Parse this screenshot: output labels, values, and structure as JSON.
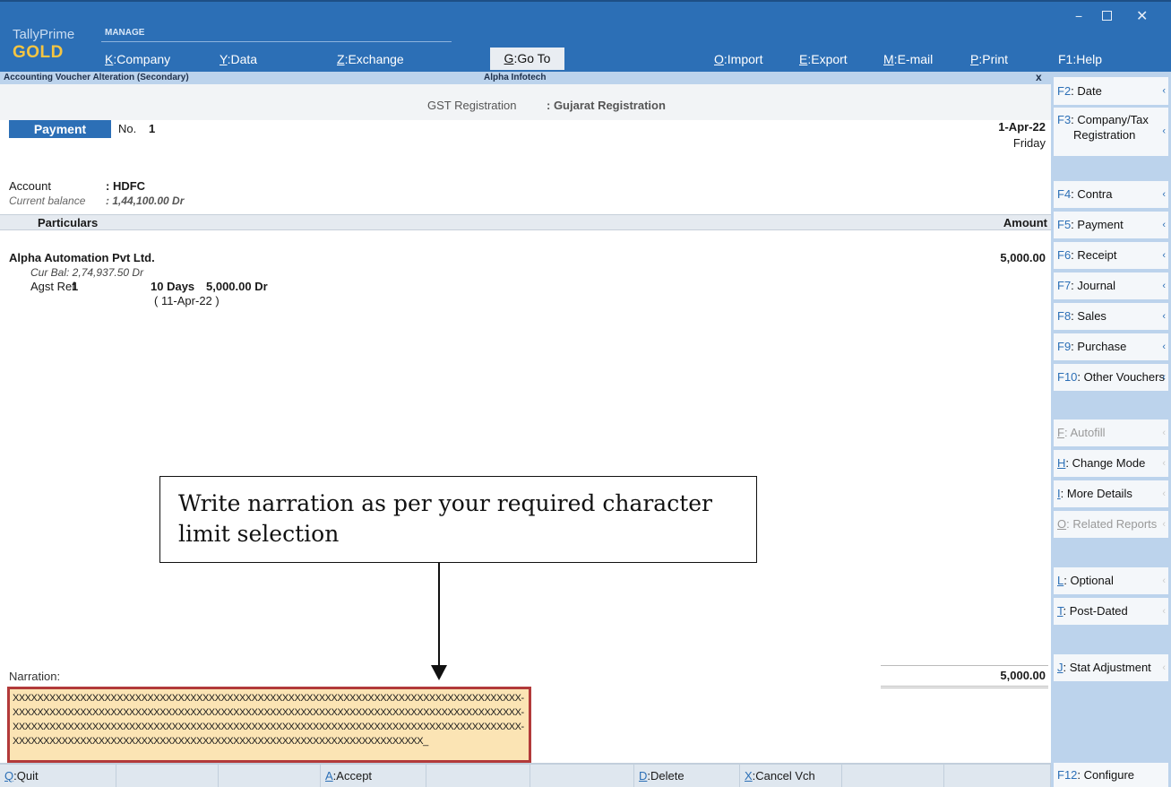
{
  "header": {
    "product": "TallyPrime",
    "edition": "GOLD",
    "manage_label": "MANAGE",
    "menu": [
      {
        "key": "K",
        "label": "Company"
      },
      {
        "key": "Y",
        "label": "Data"
      },
      {
        "key": "Z",
        "label": "Exchange"
      },
      {
        "key": "G",
        "label": "Go To"
      },
      {
        "key": "O",
        "label": "Import"
      },
      {
        "key": "E",
        "label": "Export"
      },
      {
        "key": "M",
        "label": "E-mail"
      },
      {
        "key": "P",
        "label": "Print"
      },
      {
        "key": "F1",
        "label": "Help"
      }
    ],
    "window_controls": {
      "minimize": "−",
      "close": "✕"
    }
  },
  "subbar": {
    "screen_title": "Accounting Voucher Alteration (Secondary)",
    "company": "Alpha Infotech",
    "close": "x"
  },
  "voucher": {
    "gst_label": "GST Registration",
    "gst_value": ": Gujarat Registration",
    "type": "Payment",
    "no_label": "No.",
    "no": "1",
    "date": "1-Apr-22",
    "day": "Friday",
    "account_label": "Account",
    "account_value": ": HDFC",
    "balance_label": "Current balance",
    "balance_value": ": 1,44,100.00 Dr",
    "particulars_header": "Particulars",
    "amount_header": "Amount",
    "entry": {
      "ledger": "Alpha Automation Pvt Ltd.",
      "amount": "5,000.00",
      "cur_bal": "Cur Bal:  2,74,937.50 Dr",
      "agst_label": "Agst Ref",
      "agst_ref": "1",
      "days": "10 Days",
      "agst_amount": "5,000.00 Dr",
      "due_date": "( 11-Apr-22 )"
    },
    "narration_label": "Narration:",
    "total": "5,000.00",
    "narration_lines": [
      "XXXXXXXXXXXXXXXXXXXXXXXXXXXXXXXXXXXXXXXXXXXXXXXXXXXXXXXXXXXXXXXXXXXXXXXXXXXXXXXXXXX-",
      "XXXXXXXXXXXXXXXXXXXXXXXXXXXXXXXXXXXXXXXXXXXXXXXXXXXXXXXXXXXXXXXXXXXXXXXXXXXXXXXXXXX-",
      "XXXXXXXXXXXXXXXXXXXXXXXXXXXXXXXXXXXXXXXXXXXXXXXXXXXXXXXXXXXXXXXXXXXXXXXXXXXXXXXXXXX-",
      "XXXXXXXXXXXXXXXXXXXXXXXXXXXXXXXXXXXXXXXXXXXXXXXXXXXXXXXXXXXXXXXXXXX_"
    ]
  },
  "callout": {
    "text": "Write narration as per your required character limit selection"
  },
  "bottombar": [
    {
      "key": "Q",
      "label": "Quit"
    },
    {
      "key": "",
      "label": ""
    },
    {
      "key": "",
      "label": ""
    },
    {
      "key": "A",
      "label": "Accept"
    },
    {
      "key": "",
      "label": ""
    },
    {
      "key": "",
      "label": ""
    },
    {
      "key": "D",
      "label": "Delete"
    },
    {
      "key": "X",
      "label": "Cancel Vch"
    },
    {
      "key": "",
      "label": ""
    },
    {
      "key": "",
      "label": ""
    }
  ],
  "rightpanel": {
    "buttons": [
      {
        "key": "F2",
        "label": "Date"
      },
      {
        "key": "F3",
        "label": "Company/Tax",
        "label2": "Registration"
      },
      {
        "key": "F4",
        "label": "Contra"
      },
      {
        "key": "F5",
        "label": "Payment"
      },
      {
        "key": "F6",
        "label": "Receipt"
      },
      {
        "key": "F7",
        "label": "Journal"
      },
      {
        "key": "F8",
        "label": "Sales"
      },
      {
        "key": "F9",
        "label": "Purchase"
      },
      {
        "key": "F10",
        "label": "Other Vouchers"
      },
      {
        "key": "F",
        "label": "Autofill"
      },
      {
        "key": "H",
        "label": "Change Mode"
      },
      {
        "key": "I",
        "label": "More Details"
      },
      {
        "key": "O",
        "label": "Related Reports"
      },
      {
        "key": "L",
        "label": "Optional"
      },
      {
        "key": "T",
        "label": "Post-Dated"
      },
      {
        "key": "J",
        "label": "Stat Adjustment"
      },
      {
        "key": "F12",
        "label": "Configure"
      }
    ]
  },
  "colors": {
    "header_blue": "#2c6fb6",
    "gold": "#f5c542",
    "panel_blue": "#bcd3ec",
    "narration_bg": "#fbe4b4",
    "narration_border": "#b23a3a"
  }
}
